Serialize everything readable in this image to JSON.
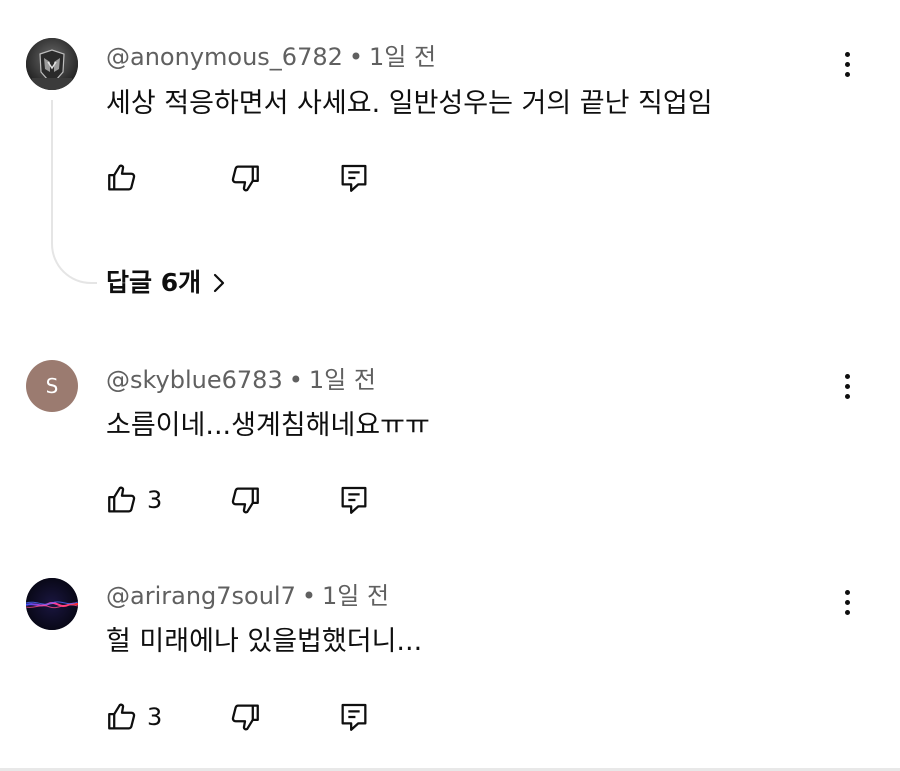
{
  "comments": [
    {
      "author": "@anonymous_6782",
      "separator": "•",
      "time": "1일 전",
      "text": "세상 적응하면서 사세요. 일반성우는 거의 끝난 직업임",
      "likes": "",
      "avatar": {
        "type": "image",
        "icon": "helmet-figure-avatar",
        "bg": "#3a3a3a"
      },
      "replies_label": "답글 6개"
    },
    {
      "author": "@skyblue6783",
      "separator": "•",
      "time": "1일 전",
      "text": "소름이네...생계침해네요ㅠㅠ",
      "likes": "3",
      "avatar": {
        "type": "letter",
        "letter": "S",
        "bg": "#9b7b70"
      }
    },
    {
      "author": "@arirang7soul7",
      "separator": "•",
      "time": "1일 전",
      "text": "헐 미래에나 있을법했더니...",
      "likes": "3",
      "avatar": {
        "type": "image",
        "icon": "sound-wave-avatar",
        "bg": "#0b0b24"
      }
    }
  ],
  "icons": {
    "like": "thumbs-up-icon",
    "dislike": "thumbs-down-icon",
    "reply": "reply-icon",
    "more": "more-vertical-icon",
    "chevron": "chevron-right-icon"
  }
}
